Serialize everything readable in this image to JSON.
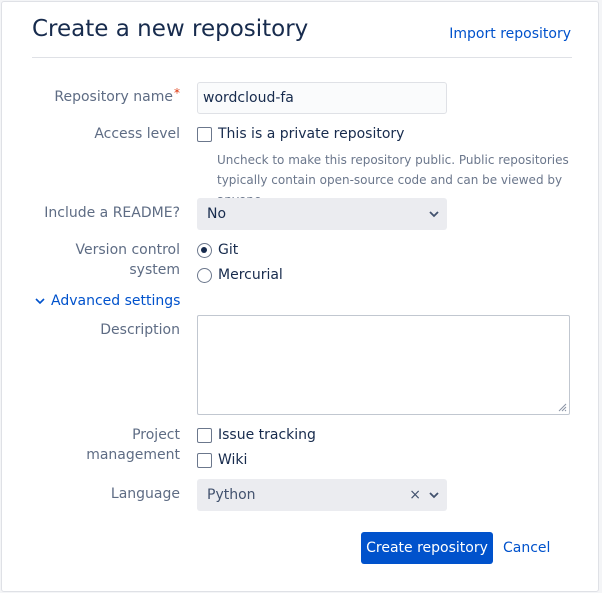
{
  "header": {
    "title": "Create a new repository",
    "import_link": "Import repository"
  },
  "form": {
    "repo_name": {
      "label": "Repository name",
      "required_mark": "*",
      "value": "wordcloud-fa"
    },
    "access_level": {
      "label": "Access level",
      "checkbox_label": "This is a private repository",
      "checked": false,
      "hint": "Uncheck to make this repository public. Public repositories typically contain open-source code and can be viewed by anyone."
    },
    "readme": {
      "label": "Include a README?",
      "selected": "No"
    },
    "vcs": {
      "label_line1": "Version control",
      "label_line2": "system",
      "options": [
        {
          "label": "Git",
          "checked": true
        },
        {
          "label": "Mercurial",
          "checked": false
        }
      ]
    },
    "advanced": {
      "label": "Advanced settings",
      "icon": "chevron-down-icon"
    },
    "description": {
      "label": "Description",
      "value": ""
    },
    "project_management": {
      "label_line1": "Project",
      "label_line2": "management",
      "options": [
        {
          "label": "Issue tracking",
          "checked": false
        },
        {
          "label": "Wiki",
          "checked": false
        }
      ]
    },
    "language": {
      "label": "Language",
      "selected": "Python",
      "clear_glyph": "×"
    }
  },
  "actions": {
    "create_label": "Create repository",
    "cancel_label": "Cancel"
  },
  "colors": {
    "primary": "#0052cc",
    "text": "#172b4d",
    "label": "#5e6c84",
    "required": "#de350b"
  }
}
